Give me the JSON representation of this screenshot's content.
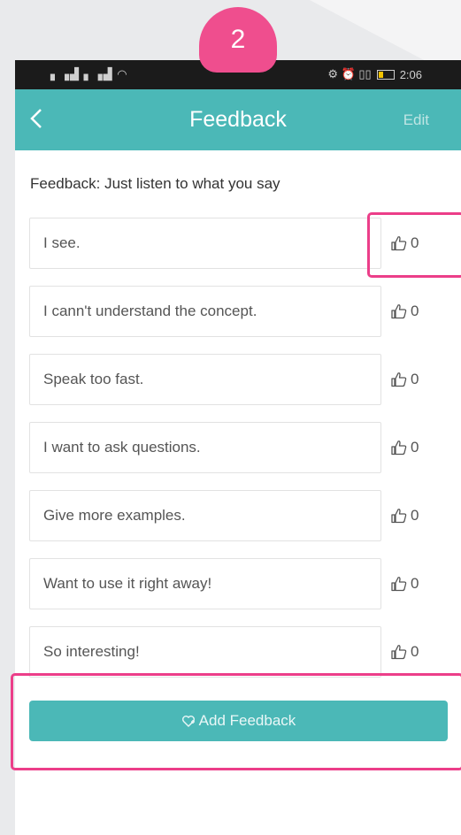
{
  "step_badge": "2",
  "status_bar": {
    "left": "³ᴵᴸ ³ᴵᴸ ≡",
    "time": "2:06"
  },
  "header": {
    "back_icon": "chevron-left-icon",
    "title": "Feedback",
    "edit_label": "Edit"
  },
  "subtitle": "Feedback: Just listen to what you say",
  "feedback_items": [
    {
      "text": "I see.",
      "likes": "0"
    },
    {
      "text": "I cann't understand the concept.",
      "likes": "0"
    },
    {
      "text": "Speak too fast.",
      "likes": "0"
    },
    {
      "text": "I want to ask questions.",
      "likes": "0"
    },
    {
      "text": "Give more examples.",
      "likes": "0"
    },
    {
      "text": "Want to use it right away!",
      "likes": "0"
    },
    {
      "text": "So interesting!",
      "likes": "0"
    }
  ],
  "add_button": {
    "label": "Add Feedback",
    "icon": "heart-plus-icon"
  },
  "colors": {
    "accent": "#4bb8b7",
    "highlight": "#ec3e89"
  }
}
